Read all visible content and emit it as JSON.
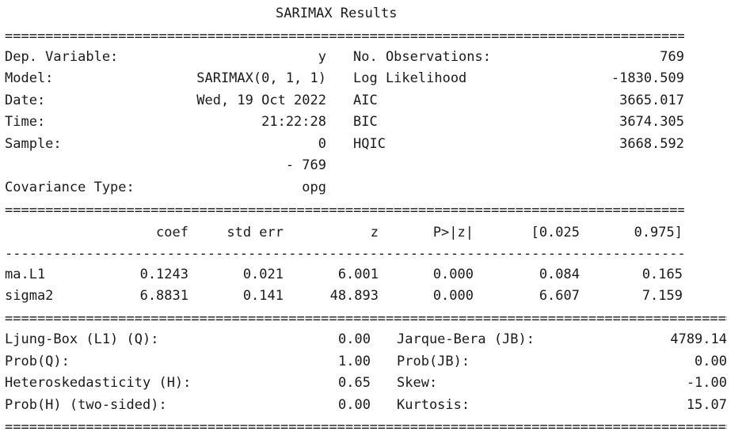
{
  "title": "SARIMAX Results",
  "separators": {
    "double": "====================================================================================================================",
    "single": "--------------------------------------------------------------------------------------------------------------------"
  },
  "header": {
    "left": [
      {
        "label": "Dep. Variable:",
        "value": "y"
      },
      {
        "label": "Model:",
        "value": "SARIMAX(0, 1, 1)"
      },
      {
        "label": "Date:",
        "value": "Wed, 19 Oct 2022"
      },
      {
        "label": "Time:",
        "value": "21:22:28"
      },
      {
        "label": "Sample:",
        "value": "0"
      },
      {
        "label": "",
        "value": "- 769"
      },
      {
        "label": "Covariance Type:",
        "value": "opg"
      }
    ],
    "right": [
      {
        "label": "No. Observations:",
        "value": "769"
      },
      {
        "label": "Log Likelihood",
        "value": "-1830.509"
      },
      {
        "label": "AIC",
        "value": "3665.017"
      },
      {
        "label": "BIC",
        "value": "3674.305"
      },
      {
        "label": "HQIC",
        "value": "3668.592"
      }
    ]
  },
  "coef_table": {
    "columns": [
      "coef",
      "std err",
      "z",
      "P>|z|",
      "[0.025",
      "0.975]"
    ],
    "rows": [
      {
        "name": "ma.L1",
        "values": [
          "0.1243",
          "0.021",
          "6.001",
          "0.000",
          "0.084",
          "0.165"
        ]
      },
      {
        "name": "sigma2",
        "values": [
          "6.8831",
          "0.141",
          "48.893",
          "0.000",
          "6.607",
          "7.159"
        ]
      }
    ]
  },
  "diagnostics": {
    "left": [
      {
        "label": "Ljung-Box (L1) (Q):",
        "value": "0.00"
      },
      {
        "label": "Prob(Q):",
        "value": "1.00"
      },
      {
        "label": "Heteroskedasticity (H):",
        "value": "0.65"
      },
      {
        "label": "Prob(H) (two-sided):",
        "value": "0.00"
      }
    ],
    "right": [
      {
        "label": "Jarque-Bera (JB):",
        "value": "4789.14"
      },
      {
        "label": "Prob(JB):",
        "value": "0.00"
      },
      {
        "label": "Skew:",
        "value": "-1.00"
      },
      {
        "label": "Kurtosis:",
        "value": "15.07"
      }
    ]
  }
}
